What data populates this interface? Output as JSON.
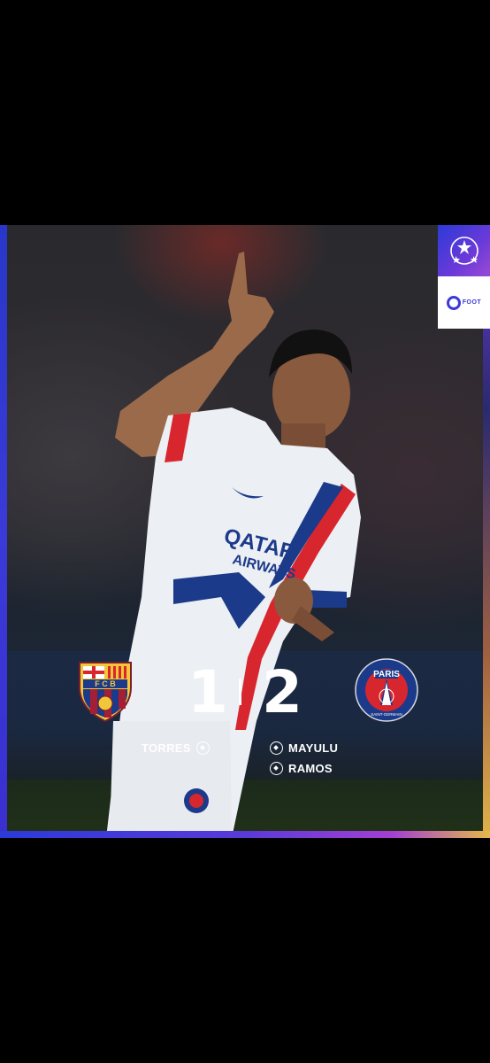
{
  "match": {
    "home_team": "FC Barcelona",
    "home_crest_text": "FCB",
    "away_team": "Paris Saint-Germain",
    "away_crest_text": "PARIS",
    "away_crest_subtext": "SAINT-GERMAIN",
    "home_score": "1",
    "away_score": "2"
  },
  "scorers": {
    "home": [
      "TORRES"
    ],
    "away": [
      "MAYULU",
      "RAMOS"
    ]
  },
  "branding": {
    "competition_icon": "champions-league-starball-icon",
    "outlet_label": "FOOT"
  },
  "colors": {
    "accent_blue": "#2b3ad8",
    "accent_purple": "#8a3ed6",
    "accent_gold": "#e6b84a",
    "psg_navy": "#1c3a8a",
    "psg_red": "#d8262e"
  }
}
